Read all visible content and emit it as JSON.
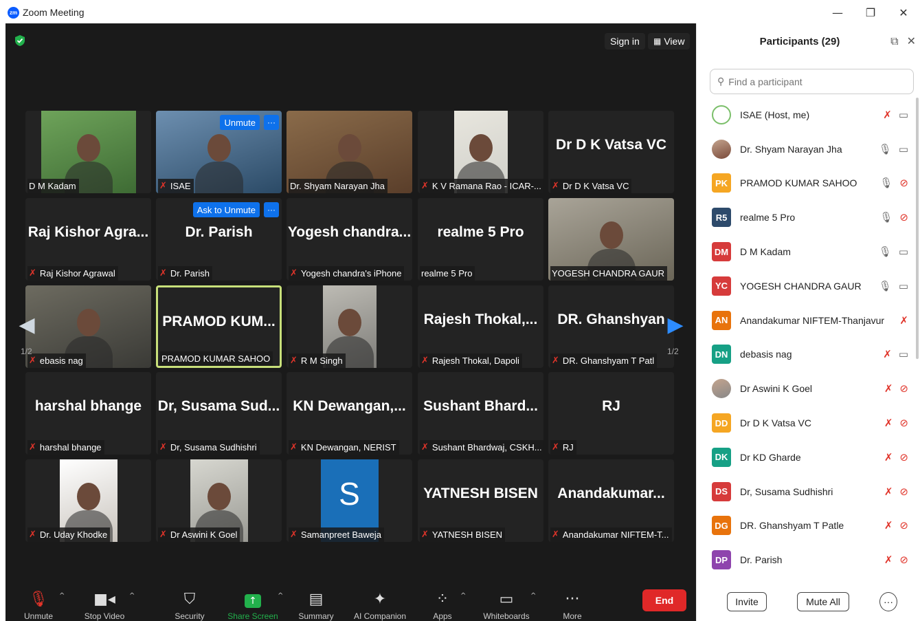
{
  "window": {
    "logo_text": "zm",
    "title": "Zoom Meeting",
    "minimize": "—",
    "maximize": "❐",
    "close": "✕"
  },
  "meeting": {
    "sign_in": "Sign in",
    "view": "View",
    "page_left": "1/2",
    "page_right": "1/2",
    "tiles": [
      {
        "label": "D M Kadam",
        "muted": false,
        "big": "",
        "photo": "person-green"
      },
      {
        "label": "ISAE",
        "muted": true,
        "big": "",
        "photo": "person-blue",
        "hover": "Unmute"
      },
      {
        "label": "Dr. Shyam Narayan Jha",
        "muted": false,
        "big": "",
        "photo": "bookshelf"
      },
      {
        "label": "K V Ramana Rao - ICAR-...",
        "muted": true,
        "big": "",
        "photo": "person-wall"
      },
      {
        "label": "Dr D K Vatsa VC",
        "muted": true,
        "big": "Dr D K Vatsa VC"
      },
      {
        "label": "Raj Kishor Agrawal",
        "muted": true,
        "big": "Raj Kishor Agra..."
      },
      {
        "label": "Dr. Parish",
        "muted": true,
        "big": "Dr. Parish",
        "hover": "Ask to Unmute"
      },
      {
        "label": "Yogesh chandra's iPhone",
        "muted": true,
        "big": "Yogesh chandra..."
      },
      {
        "label": "realme 5 Pro",
        "muted": false,
        "big": "realme 5 Pro"
      },
      {
        "label": "YOGESH CHANDRA GAUR",
        "muted": false,
        "big": "",
        "photo": "office"
      },
      {
        "label": "ebasis nag",
        "muted": true,
        "big": "",
        "photo": "person-dark"
      },
      {
        "label": "PRAMOD KUMAR SAHOO",
        "muted": false,
        "big": "PRAMOD KUM...",
        "active": true
      },
      {
        "label": "R M Singh",
        "muted": true,
        "big": "",
        "photo": "person-window"
      },
      {
        "label": "Rajesh Thokal, Dapoli",
        "muted": true,
        "big": "Rajesh Thokal,..."
      },
      {
        "label": "DR. Ghanshyam T Patl",
        "muted": true,
        "big": "DR. Ghanshyan"
      },
      {
        "label": "harshal bhange",
        "muted": true,
        "big": "harshal bhange"
      },
      {
        "label": "Dr, Susama Sudhishri",
        "muted": true,
        "big": "Dr, Susama Sud..."
      },
      {
        "label": "KN Dewangan, NERIST",
        "muted": true,
        "big": "KN Dewangan,..."
      },
      {
        "label": "Sushant Bhardwaj, CSKH...",
        "muted": true,
        "big": "Sushant Bhard..."
      },
      {
        "label": "RJ",
        "muted": true,
        "big": "RJ"
      },
      {
        "label": "Dr. Uday Khodke",
        "muted": true,
        "big": "",
        "photo": "portrait"
      },
      {
        "label": "Dr Aswini K Goel",
        "muted": true,
        "big": "",
        "photo": "portrait2"
      },
      {
        "label": "Samanpreet Baweja",
        "muted": true,
        "big": "",
        "photo": "letter-s",
        "letter": "S"
      },
      {
        "label": "YATNESH BISEN",
        "muted": true,
        "big": "YATNESH BISEN"
      },
      {
        "label": "Anandakumar NIFTEM-T...",
        "muted": true,
        "big": "Anandakumar..."
      }
    ]
  },
  "toolbar": {
    "items": [
      {
        "label": "Unmute",
        "icon": "mic-muted-icon"
      },
      {
        "label": "Stop Video",
        "icon": "video-icon"
      },
      {
        "label": "Security",
        "icon": "shield-icon"
      },
      {
        "label": "Share Screen",
        "icon": "share-screen-icon"
      },
      {
        "label": "Summary",
        "icon": "summary-icon"
      },
      {
        "label": "AI Companion",
        "icon": "sparkle-icon"
      },
      {
        "label": "Apps",
        "icon": "apps-icon"
      },
      {
        "label": "Whiteboards",
        "icon": "whiteboard-icon"
      },
      {
        "label": "More",
        "icon": "more-icon"
      }
    ],
    "end": "End"
  },
  "panel": {
    "title": "Participants (29)",
    "search_placeholder": "Find a participant",
    "participants": [
      {
        "name": "ISAE (Host, me)",
        "initials": "",
        "color": "#ffffff",
        "mic": "muted",
        "video": "on"
      },
      {
        "name": "Dr. Shyam Narayan Jha",
        "initials": "",
        "color": "#7a4a3a",
        "mic": "on",
        "video": "on"
      },
      {
        "name": "PRAMOD KUMAR SAHOO",
        "initials": "PK",
        "color": "#f5a623",
        "mic": "on",
        "video": "off"
      },
      {
        "name": "realme 5 Pro",
        "initials": "R5",
        "color": "#2d4a6b",
        "mic": "on",
        "video": "off"
      },
      {
        "name": "D M Kadam",
        "initials": "DM",
        "color": "#d63b3b",
        "mic": "on",
        "video": "on"
      },
      {
        "name": "YOGESH CHANDRA GAUR",
        "initials": "YC",
        "color": "#d63b3b",
        "mic": "on",
        "video": "on"
      },
      {
        "name": "Anandakumar NIFTEM-Thanjavur",
        "initials": "AN",
        "color": "#e8730c",
        "mic": "muted",
        "video": "none"
      },
      {
        "name": "debasis nag",
        "initials": "DN",
        "color": "#16a085",
        "mic": "muted",
        "video": "on"
      },
      {
        "name": "Dr Aswini K Goel",
        "initials": "",
        "color": "#888888",
        "mic": "muted",
        "video": "off"
      },
      {
        "name": "Dr D K Vatsa VC",
        "initials": "DD",
        "color": "#f5a623",
        "mic": "muted",
        "video": "off"
      },
      {
        "name": "Dr KD Gharde",
        "initials": "DK",
        "color": "#16a085",
        "mic": "muted",
        "video": "off"
      },
      {
        "name": "Dr, Susama Sudhishri",
        "initials": "DS",
        "color": "#d63b3b",
        "mic": "muted",
        "video": "off"
      },
      {
        "name": "DR. Ghanshyam T Patle",
        "initials": "DG",
        "color": "#e8730c",
        "mic": "muted",
        "video": "off"
      },
      {
        "name": "Dr. Parish",
        "initials": "DP",
        "color": "#8e44ad",
        "mic": "muted",
        "video": "off"
      }
    ],
    "invite": "Invite",
    "mute_all": "Mute All",
    "more": "···"
  }
}
